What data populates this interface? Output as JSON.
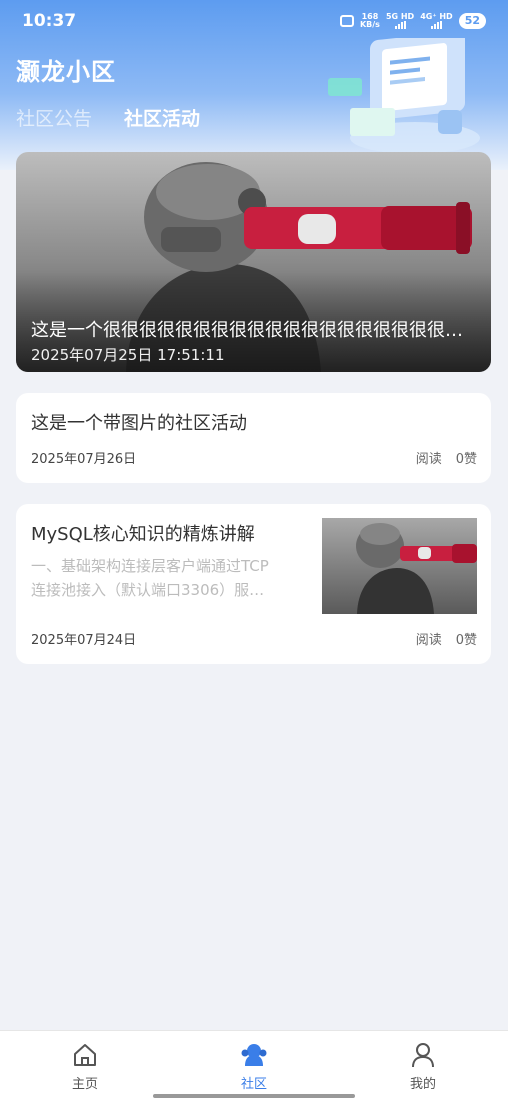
{
  "status_bar": {
    "time": "10:37",
    "net_speed": "168",
    "net_unit": "KB/s",
    "sim1": "5G HD",
    "sim2": "4G⁺ HD",
    "battery": "52"
  },
  "header": {
    "title": "灏龙小区",
    "tabs": [
      {
        "label": "社区公告",
        "active": false
      },
      {
        "label": "社区活动",
        "active": true
      }
    ]
  },
  "banner": {
    "title": "这是一个很很很很很很很很很很很很很很很很很很很很很很很很很很很很长的社区活动标题",
    "time": "2025年07月25日 17:51:11"
  },
  "posts": [
    {
      "title": "这是一个带图片的社区活动",
      "date": "2025年07月26日",
      "read_label": "阅读",
      "like_label": "0赞"
    },
    {
      "title": "MySQL核心知识的精炼讲解",
      "desc_line1": "一、基础架构连接层客户端通过TCP",
      "desc_line2": "连接池接入（默认端口3306）服…",
      "date": "2025年07月24日",
      "read_label": "阅读",
      "like_label": "0赞"
    }
  ],
  "bottom_nav": [
    {
      "label": "主页",
      "icon": "home-icon",
      "active": false
    },
    {
      "label": "社区",
      "icon": "community-icon",
      "active": true
    },
    {
      "label": "我的",
      "icon": "profile-icon",
      "active": false
    }
  ],
  "colors": {
    "accent": "#3a7ee8",
    "header_top": "#5d9cf0",
    "background": "#f0f2f7"
  }
}
